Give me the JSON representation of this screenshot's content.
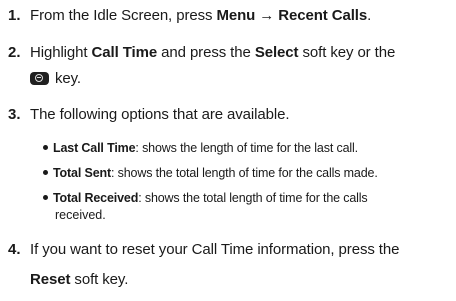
{
  "steps": [
    {
      "number": "1.",
      "pre": "From the Idle Screen, press ",
      "bold1": "Menu",
      "arrow": " → ",
      "bold2": "Recent Calls",
      "post": "."
    },
    {
      "number": "2.",
      "pre": "Highlight ",
      "bold1": "Call Time",
      "mid": " and press the ",
      "bold2": "Select",
      "post": " soft key or the",
      "line2_icon": "select-key-icon",
      "line2_text": "key."
    },
    {
      "number": "3.",
      "text": "The following options that are available.",
      "bullets": [
        {
          "term": "Last Call Time",
          "desc": ": shows the length of time for the last call."
        },
        {
          "term": "Total Sent",
          "desc": ": shows the total length of time for the calls made."
        },
        {
          "term": "Total Received",
          "desc": ": shows the total length of time for the calls",
          "cont": "received."
        }
      ]
    },
    {
      "number": "4.",
      "text": "If you want to reset your Call Time information, press the",
      "line2_bold": "Reset",
      "line2_text": " soft key."
    }
  ]
}
